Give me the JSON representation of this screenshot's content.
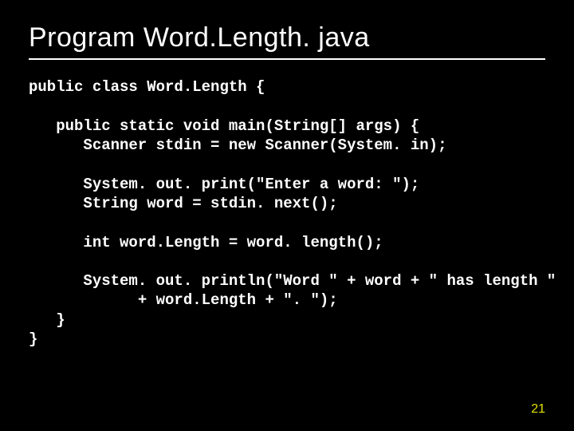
{
  "title": "Program Word.Length. java",
  "code": {
    "l1": "public class Word.Length {",
    "l2": "",
    "l3": "   public static void main(String[] args) {",
    "l4": "      Scanner stdin = new Scanner(System. in);",
    "l5": "",
    "l6": "      System. out. print(\"Enter a word: \");",
    "l7": "      String word = stdin. next();",
    "l8": "",
    "l9": "      int word.Length = word. length();",
    "l10": "",
    "l11": "      System. out. println(\"Word \" + word + \" has length \"",
    "l12": "            + word.Length + \". \");",
    "l13": "   }",
    "l14": "}"
  },
  "page_number": "21"
}
